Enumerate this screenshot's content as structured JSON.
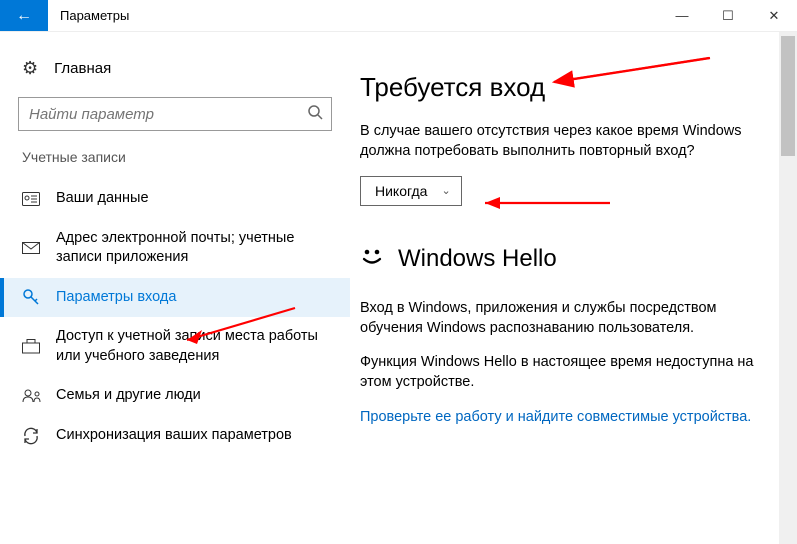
{
  "titlebar": {
    "title": "Параметры"
  },
  "sidebar": {
    "home": "Главная",
    "search_placeholder": "Найти параметр",
    "section": "Учетные записи",
    "items": [
      {
        "label": "Ваши данные"
      },
      {
        "label": "Адрес электронной почты; учетные записи приложения"
      },
      {
        "label": "Параметры входа"
      },
      {
        "label": "Доступ к учетной записи места работы или учебного заведения"
      },
      {
        "label": "Семья и другие люди"
      },
      {
        "label": "Синхронизация ваших параметров"
      }
    ]
  },
  "main": {
    "signin_heading": "Требуется вход",
    "signin_question": "В случае вашего отсутствия через какое время Windows должна потребовать выполнить повторный вход?",
    "signin_value": "Никогда",
    "hello_heading": "Windows Hello",
    "hello_para1": "Вход в Windows, приложения и службы посредством обучения Windows распознаванию пользователя.",
    "hello_para2": "Функция Windows Hello в настоящее время недоступна на этом устройстве.",
    "hello_link": "Проверьте ее работу и найдите совместимые устройства."
  }
}
